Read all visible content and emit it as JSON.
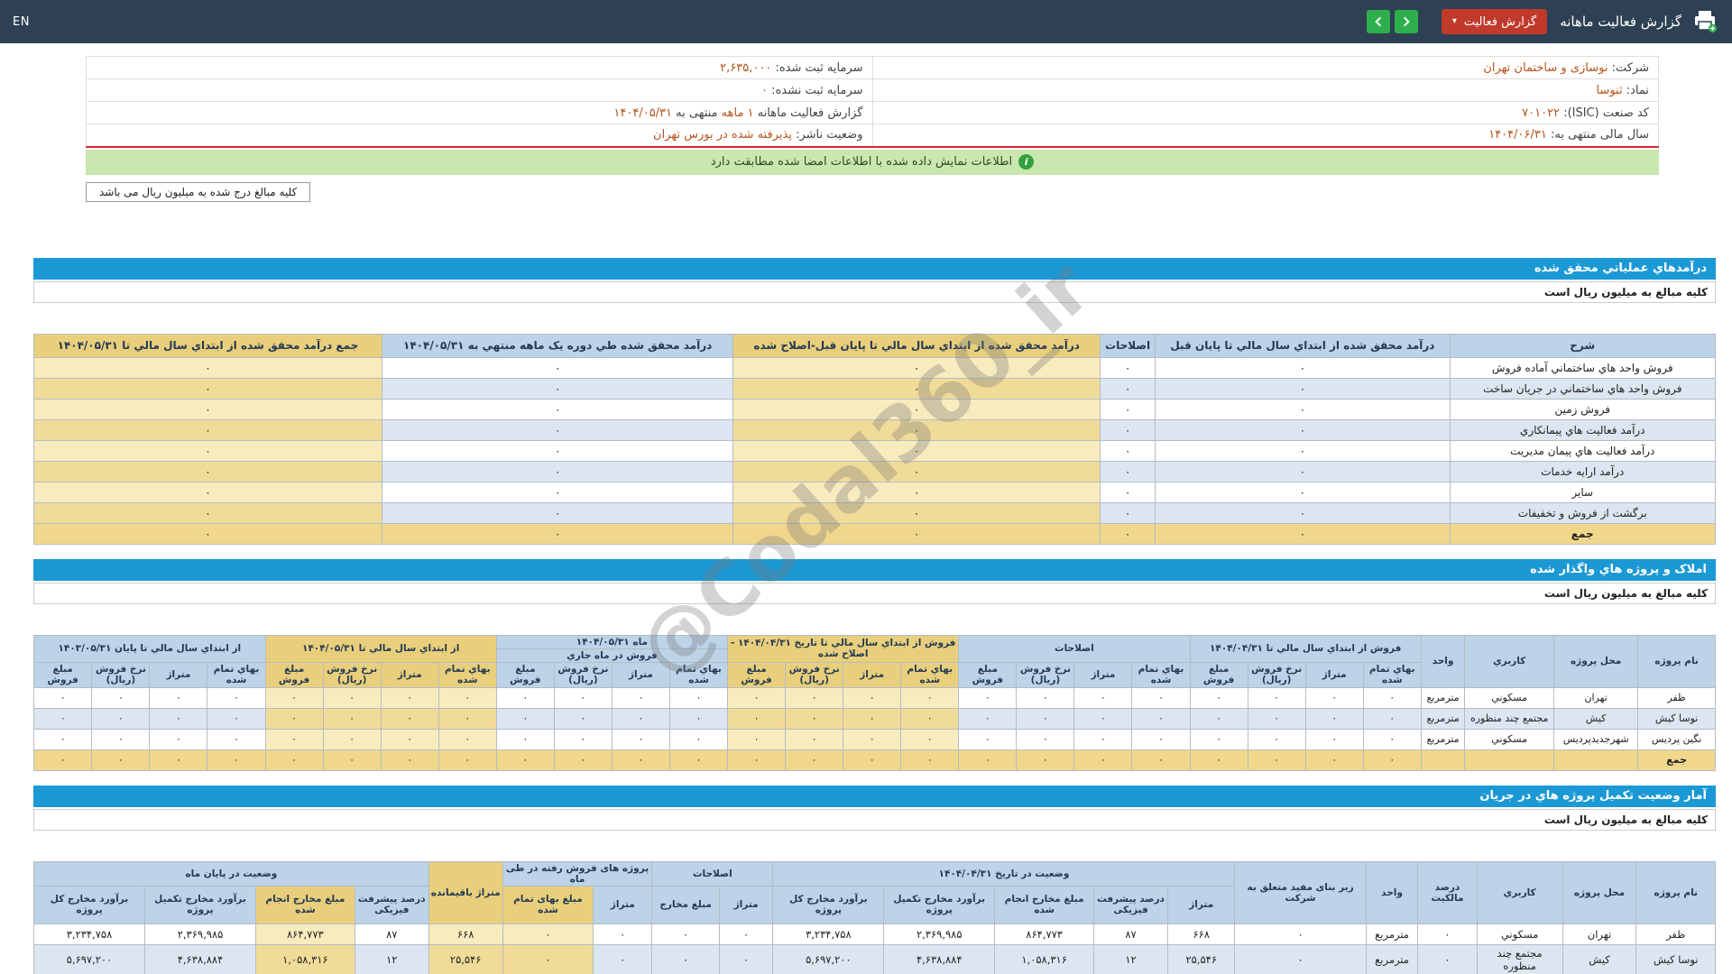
{
  "theme": {
    "topbar_bg": "#2e4053",
    "accent_green": "#2db04c",
    "accent_red": "#c0392b",
    "section_blue": "#1b99d5",
    "highlight_tan": "#e9cf7c",
    "link_orange": "#b5541c",
    "notice_green_bg": "#c9e7ae",
    "red_divider": "#d42b33"
  },
  "topbar": {
    "lang_toggle": "EN",
    "title": "گزارش فعالیت ماهانه",
    "report_dropdown": "گزارش فعالیت",
    "icons": {
      "print": "printer-plus-icon",
      "nav_forward": "chevron-right-icon",
      "nav_back": "chevron-left-icon",
      "dropdown": "chevron-down-icon"
    }
  },
  "info": {
    "company_label": "شرکت:",
    "company_value": "نوسازی و ساختمان تهران",
    "reg_capital_label": "سرمایه ثبت شده:",
    "reg_capital_value": "۲,۶۳۵,۰۰۰",
    "symbol_label": "نماد:",
    "symbol_value": "ثنوسا",
    "unreg_capital_label": "سرمایه ثبت نشده:",
    "unreg_capital_value": "۰",
    "isic_label": "کد صنعت (ISIC):",
    "isic_value": "۷۰۱۰۲۲",
    "report_label": "گزارش فعالیت ماهانه",
    "report_period": "۱ ماهه",
    "report_until": "منتهی به",
    "report_date": "۱۴۰۴/۰۵/۳۱",
    "fiscal_label": "سال مالی منتهی به:",
    "fiscal_value": "۱۴۰۴/۰۶/۳۱",
    "issuer_label": "وضعیت ناشر:",
    "issuer_value": "پذیرفته شده در بورس تهران"
  },
  "notice": {
    "signed_match": "اطلاعات نمایش داده شده با اطلاعات امضا شده مطابقت دارد",
    "amounts_box": "کلیه مبالغ درج شده به میلیون ریال می باشد"
  },
  "watermark": "@Codal360_ir",
  "section1": {
    "title": "درآمدهاي عملياتي محقق شده",
    "amounts_note": "کلیه مبالغ به میلیون ریال است",
    "table": {
      "headers": [
        "شرح",
        "درآمد محقق شده از ابتداي سال مالي تا پایان قبل",
        "اصلاحات",
        "درآمد محقق شده از ابتداي سال مالي تا پایان قبل-اصلاح شده",
        "درآمد محقق شده طي دوره یک ماهه منتهي به ۱۴۰۴/۰۵/۳۱",
        "جمع درآمد محقق شده از ابتداي سال مالي تا ۱۴۰۴/۰۵/۳۱"
      ],
      "highlight_cols": [
        3,
        5
      ],
      "rows": [
        {
          "label": "فروش واحد هاي ساختماني آماده فروش",
          "values": [
            "۰",
            "۰",
            "۰",
            "۰",
            "۰"
          ]
        },
        {
          "label": "فروش واحد هاي ساختماني در جریان ساخت",
          "values": [
            "۰",
            "۰",
            "۰",
            "۰",
            "۰"
          ]
        },
        {
          "label": "فروش زمین",
          "values": [
            "۰",
            "۰",
            "۰",
            "۰",
            "۰"
          ]
        },
        {
          "label": "درآمد فعالیت هاي پیمانکاري",
          "values": [
            "۰",
            "۰",
            "۰",
            "۰",
            "۰"
          ]
        },
        {
          "label": "درآمد فعالیت هاي پیمان مدیریت",
          "values": [
            "۰",
            "۰",
            "۰",
            "۰",
            "۰"
          ]
        },
        {
          "label": "درآمد ارایه خدمات",
          "values": [
            "۰",
            "۰",
            "۰",
            "۰",
            "۰"
          ]
        },
        {
          "label": "سایر",
          "values": [
            "۰",
            "۰",
            "۰",
            "۰",
            "۰"
          ]
        },
        {
          "label": "برگشت از فروش و تخفیفات",
          "values": [
            "۰",
            "۰",
            "۰",
            "۰",
            "۰"
          ]
        },
        {
          "label": "جمع",
          "values": [
            "۰",
            "۰",
            "۰",
            "۰",
            "۰"
          ],
          "total": true
        }
      ]
    }
  },
  "section2": {
    "title": "املاک و پروژه هاي واگذار شده",
    "amounts_note": "کلیه مبالغ به میلیون ریال است",
    "table": {
      "info_headers": [
        "نام پروژه",
        "محل پروژه",
        "کاربري",
        "واحد"
      ],
      "groups": [
        {
          "label": "فروش از ابتداي سال مالي تا ۱۴۰۴/۰۴/۳۱"
        },
        {
          "label": "اصلاحات"
        },
        {
          "label": "فروش از ابتداي سال مالي تا تاریخ ۱۴۰۴/۰۴/۳۱ - اصلاح شده",
          "highlight": true
        },
        {
          "label": "ماه ۱۴۰۴/۰۵/۳۱",
          "sub": "فروش در ماه جاري"
        },
        {
          "label": "از ابتداي سال مالي تا ۱۴۰۴/۰۵/۳۱",
          "highlight": true
        },
        {
          "label": "از ابتداي سال مالي تا پایان ۱۴۰۳/۰۵/۳۱"
        }
      ],
      "subcols": [
        "بهاي تمام شده",
        "متراژ",
        "نرخ فروش (ریال)",
        "مبلغ فروش"
      ],
      "rows": [
        {
          "name": "ظفر",
          "location": "تهران",
          "usage": "مسکوني",
          "unit": "مترمربع",
          "values": [
            "۰",
            "۰",
            "۰",
            "۰",
            "۰",
            "۰",
            "۰",
            "۰",
            "۰",
            "۰",
            "۰",
            "۰",
            "۰",
            "۰",
            "۰",
            "۰",
            "۰",
            "۰",
            "۰",
            "۰",
            "۰",
            "۰",
            "۰",
            "۰"
          ]
        },
        {
          "name": "نوسا کیش",
          "location": "کیش",
          "usage": "مجتمع چند منظوره",
          "unit": "مترمربع",
          "values": [
            "۰",
            "۰",
            "۰",
            "۰",
            "۰",
            "۰",
            "۰",
            "۰",
            "۰",
            "۰",
            "۰",
            "۰",
            "۰",
            "۰",
            "۰",
            "۰",
            "۰",
            "۰",
            "۰",
            "۰",
            "۰",
            "۰",
            "۰",
            "۰"
          ]
        },
        {
          "name": "نگین پردیس",
          "location": "شهرجدیدپردیس",
          "usage": "مسکوني",
          "unit": "مترمربع",
          "values": [
            "۰",
            "۰",
            "۰",
            "۰",
            "۰",
            "۰",
            "۰",
            "۰",
            "۰",
            "۰",
            "۰",
            "۰",
            "۰",
            "۰",
            "۰",
            "۰",
            "۰",
            "۰",
            "۰",
            "۰",
            "۰",
            "۰",
            "۰",
            "۰"
          ]
        },
        {
          "name": "جمع",
          "location": "",
          "usage": "",
          "unit": "",
          "values": [
            "۰",
            "۰",
            "۰",
            "۰",
            "۰",
            "۰",
            "۰",
            "۰",
            "۰",
            "۰",
            "۰",
            "۰",
            "۰",
            "۰",
            "۰",
            "۰",
            "۰",
            "۰",
            "۰",
            "۰",
            "۰",
            "۰",
            "۰",
            "۰"
          ],
          "total": true
        }
      ]
    }
  },
  "section3": {
    "title": "آمار وضعیت تکمیل پروژه هاي در جریان",
    "amounts_note": "کلیه مبالغ به میلیون ریال است",
    "table": {
      "info_headers": [
        "نام پروژه",
        "محل پروژه",
        "کاربري",
        "درصد مالکیت",
        "واحد",
        "زیر بنای مفید متعلق به شرکت"
      ],
      "groups": [
        {
          "label": "وضعیت در تاریخ ۱۴۰۴/۰۴/۳۱",
          "cols": [
            "متراژ",
            "درصد پیشرفت فیزیکی",
            "مبلغ مخارج انجام شده",
            "برآورد مخارج تکمیل پروژه",
            "برآورد مخارج کل پروژه"
          ]
        },
        {
          "label": "اصلاحات",
          "cols": [
            "متراژ",
            "مبلغ مخارج"
          ]
        },
        {
          "label": "پروژه های فروش رفته در طی ماه",
          "cols": [
            "متراژ",
            "مبلغ بهای تمام شده"
          ]
        },
        {
          "label": "متراژ باقیمانده",
          "standalone": true,
          "highlight": true,
          "cols": []
        },
        {
          "label": "وضعیت در پایان ماه",
          "cols": [
            "درصد پیشرفت فیزیکی",
            "مبلغ مخارج انجام شده",
            "برآورد مخارج تکمیل پروژه",
            "برآورد مخارج کل پروژه"
          ]
        }
      ],
      "rows": [
        {
          "name": "ظفر",
          "location": "تهران",
          "usage": "مسکوني",
          "ownership": "۰",
          "unit": "مترمربع",
          "area": "۰",
          "values": [
            "۶۶۸",
            "۸۷",
            "۸۶۴,۷۷۳",
            "۲,۳۶۹,۹۸۵",
            "۳,۲۳۴,۷۵۸",
            "۰",
            "۰",
            "۰",
            "۰",
            "۶۶۸",
            "۸۷",
            "۸۶۴,۷۷۳",
            "۲,۳۶۹,۹۸۵",
            "۳,۲۳۴,۷۵۸"
          ]
        },
        {
          "name": "نوسا کیش",
          "location": "کیش",
          "usage": "مجتمع چند منظوره",
          "ownership": "۰",
          "unit": "مترمربع",
          "area": "۰",
          "values": [
            "۲۵,۵۴۶",
            "۱۲",
            "۱,۰۵۸,۳۱۶",
            "۴,۶۳۸,۸۸۴",
            "۵,۶۹۷,۲۰۰",
            "۰",
            "۰",
            "۰",
            "۰",
            "۲۵,۵۴۶",
            "۱۲",
            "۱,۰۵۸,۳۱۶",
            "۴,۶۳۸,۸۸۴",
            "۵,۶۹۷,۲۰۰"
          ]
        }
      ]
    }
  }
}
